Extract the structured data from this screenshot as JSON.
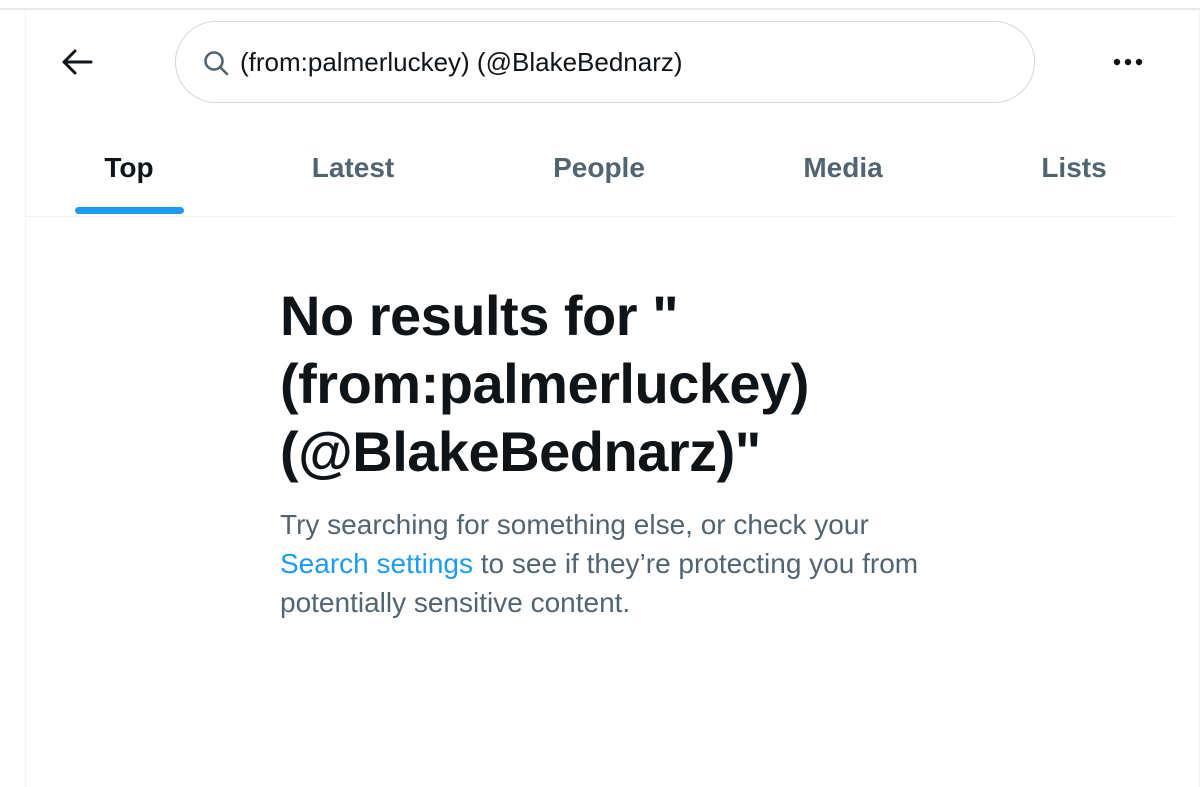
{
  "header": {
    "back_icon": "arrow-left-icon",
    "search": {
      "value": "(from:palmerluckey) (@BlakeBednarz)",
      "icon": "search-icon"
    },
    "more_icon": "more-horizontal-icon"
  },
  "tabs": [
    {
      "label": "Top",
      "active": true
    },
    {
      "label": "Latest",
      "active": false
    },
    {
      "label": "People",
      "active": false
    },
    {
      "label": "Media",
      "active": false
    },
    {
      "label": "Lists",
      "active": false
    }
  ],
  "empty_state": {
    "title": "No results for \"(from:palmerluckey) (@BlakeBednarz)\"",
    "desc_before": "Try searching for something else, or check your ",
    "link": "Search settings",
    "desc_after": " to see if they’re protecting you from potentially sensitive content."
  },
  "colors": {
    "accent": "#1d9bf0",
    "text_primary": "#0f1419",
    "text_secondary": "#536471",
    "border": "#cfd9de"
  }
}
